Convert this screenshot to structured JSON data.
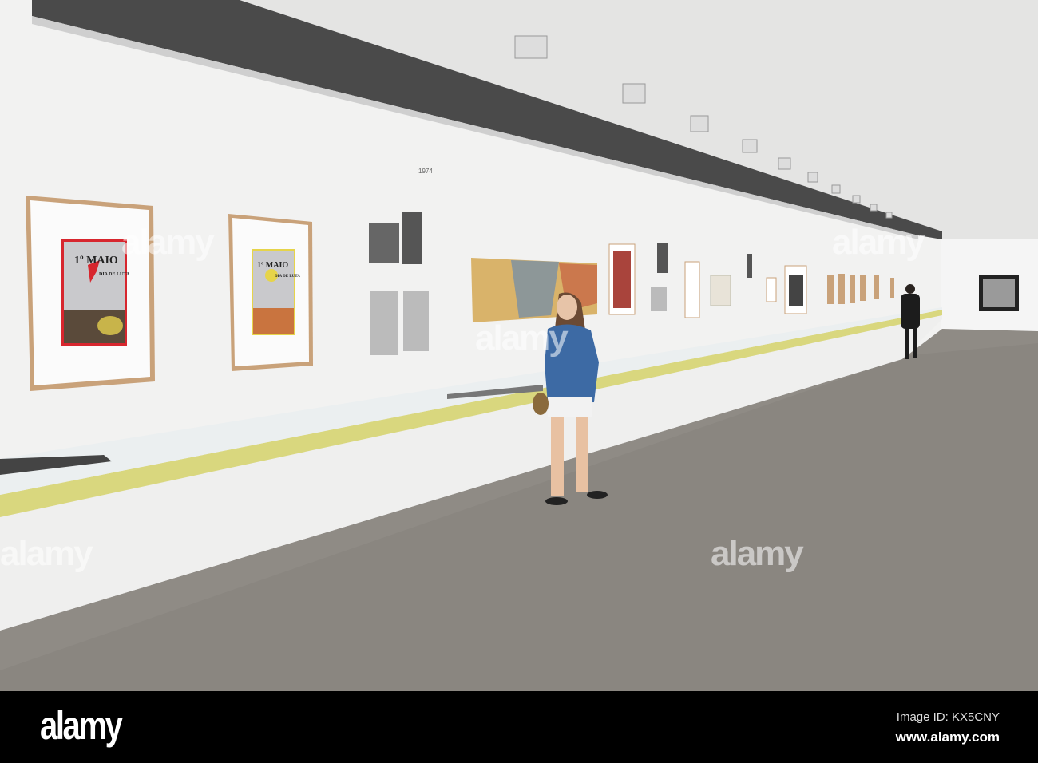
{
  "scene": {
    "posters": [
      {
        "title": "1º MAIO",
        "subtitle": "DIA DE LUTA"
      },
      {
        "title": "1º MAIO",
        "subtitle": "DIA DE LUTA"
      }
    ],
    "wall_year": "1974"
  },
  "watermark": {
    "text": "alamy"
  },
  "footer": {
    "logo": "alamy",
    "image_id": "Image ID: KX5CNY",
    "url": "www.alamy.com"
  },
  "colors": {
    "wall": "#f3f3f2",
    "floor": "#8f8b85",
    "strip": "#d9d77e",
    "frame": "#c9a27a"
  }
}
